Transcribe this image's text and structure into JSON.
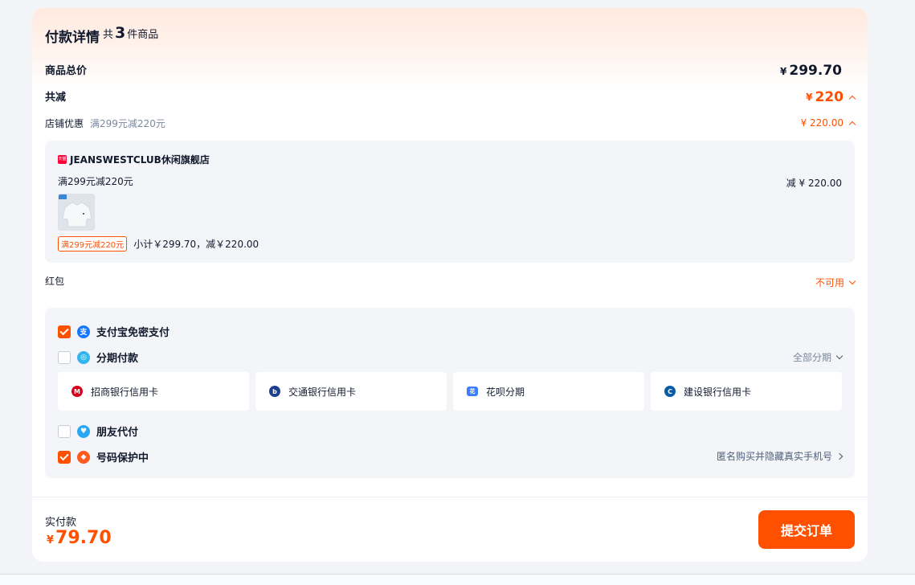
{
  "header": {
    "title": "付款详情",
    "count_prefix": "共",
    "count": "3",
    "count_suffix": "件商品"
  },
  "summary": {
    "total_label": "商品总价",
    "total_currency": "¥",
    "total_value": "299.70",
    "discount_label": "共减",
    "discount_currency": "¥",
    "discount_value": "220"
  },
  "shop_promo": {
    "label": "店铺优惠",
    "desc": "满299元减220元",
    "amount": "¥ 220.00",
    "shop_icon_text": "天猫",
    "shop_name": "JEANSWESTCLUB休闲旗舰店",
    "rule": "满299元减220元",
    "reduce": "减 ¥ 220.00",
    "tag": "满299元减220元",
    "subtotal": "小计￥299.70，减￥220.00"
  },
  "red_packet": {
    "label": "红包",
    "status": "不可用"
  },
  "payment": {
    "alipay": {
      "label": "支付宝免密支付",
      "checked": true
    },
    "installment": {
      "label": "分期付款",
      "checked": false,
      "all_label": "全部分期"
    },
    "banks": [
      {
        "name": "招商银行信用卡",
        "icon": "cmb-icon"
      },
      {
        "name": "交通银行信用卡",
        "icon": "bocom-icon"
      },
      {
        "name": "花呗分期",
        "icon": "huabei-icon"
      },
      {
        "name": "建设银行信用卡",
        "icon": "ccb-icon"
      }
    ],
    "friend_pay": {
      "label": "朋友代付",
      "checked": false
    },
    "number_protect": {
      "label": "号码保护中",
      "checked": true,
      "hint": "匿名购买并隐藏真实手机号"
    }
  },
  "footer": {
    "paid_label": "实付款",
    "currency": "¥",
    "paid_value": "79.70",
    "submit_label": "提交订单"
  },
  "colors": {
    "accent": "#ff5000",
    "panel_bg": "#f3f5f8",
    "page_bg": "#f2f4f7"
  }
}
